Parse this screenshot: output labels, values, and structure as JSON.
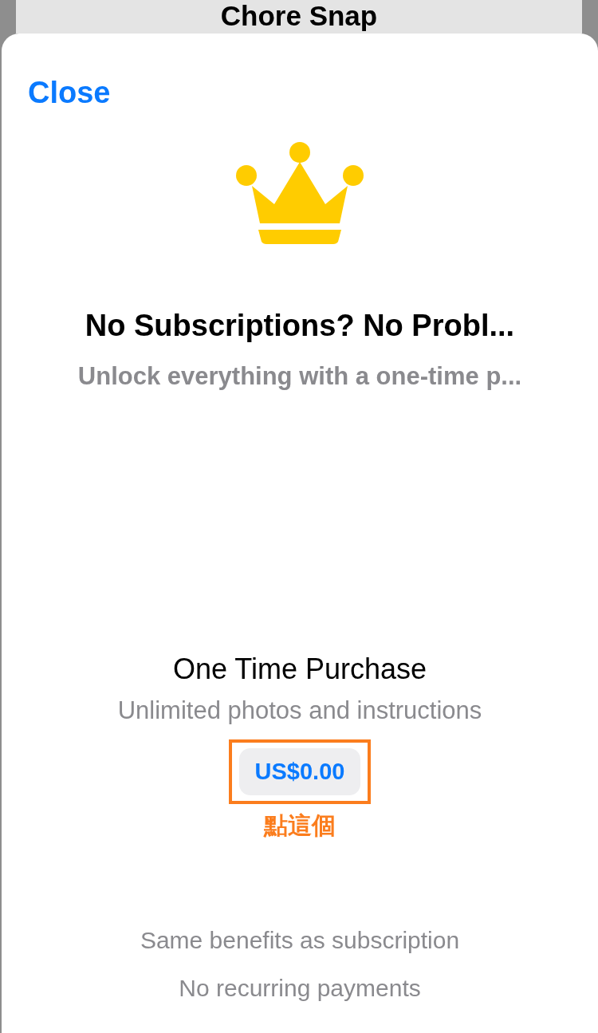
{
  "background_title": "Chore Snap",
  "sheet": {
    "close": "Close",
    "title": "No Subscriptions? No Probl...",
    "subtitle": "Unlock everything with a one-time p...",
    "offer": {
      "name": "One Time Purchase",
      "description": "Unlimited photos and instructions",
      "price": "US$0.00",
      "highlighted": true,
      "annotation": "點這個"
    },
    "benefits": [
      "Same benefits as subscription",
      "No recurring payments"
    ]
  }
}
